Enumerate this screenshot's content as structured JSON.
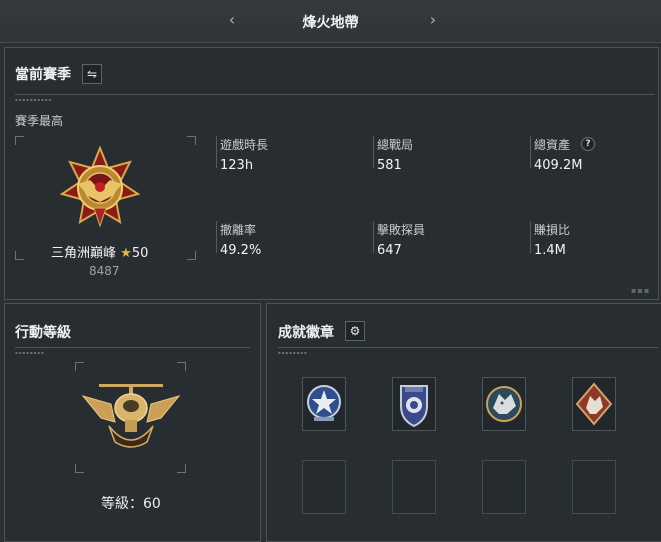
{
  "header": {
    "title": "烽火地帶",
    "prev_icon": "‹",
    "next_icon": "›"
  },
  "season": {
    "title": "當前賽季",
    "switch_icon": "⇋",
    "best_label": "賽季最高",
    "rank_name": "三角洲巔峰",
    "rank_star": "★",
    "rank_stars": "50",
    "rank_score": "8487",
    "stats": [
      {
        "label": "遊戲時長",
        "value": "123h"
      },
      {
        "label": "總戰局",
        "value": "581"
      },
      {
        "label": "總資產",
        "value": "409.2M"
      },
      {
        "label": "撤離率",
        "value": "49.2%"
      },
      {
        "label": "擊敗探員",
        "value": "647"
      },
      {
        "label": "賺損比",
        "value": "1.4M"
      }
    ],
    "help_icon": "?"
  },
  "operation": {
    "title": "行動等級",
    "level_text": "等級：60"
  },
  "achievements": {
    "title": "成就徽章",
    "settings_icon": "⚙",
    "badges": [
      "star-shield-badge",
      "police-shield-badge",
      "wolf-round-badge",
      "wolf-diamond-badge"
    ],
    "empty_slots": 4
  }
}
